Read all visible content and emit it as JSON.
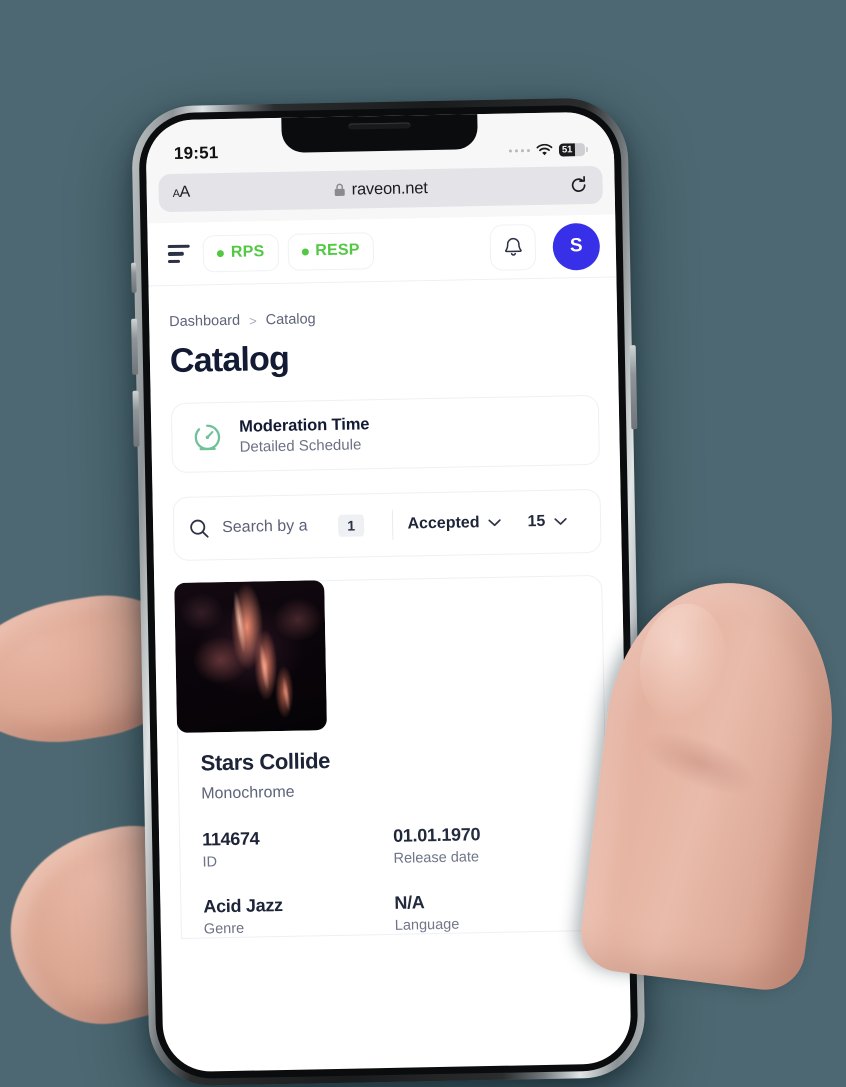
{
  "status_bar": {
    "time": "19:51",
    "battery_level": "51",
    "wifi_icon": "wifi-icon",
    "signal_icon": "signal-dots-icon"
  },
  "browser": {
    "text_size_label": "AA",
    "lock_icon": "lock-icon",
    "url": "raveon.net",
    "reload_icon": "reload-icon"
  },
  "app_header": {
    "menu_icon": "hamburger-menu-icon",
    "chips": [
      {
        "label": "RPS",
        "dot_color": "#52c843"
      },
      {
        "label": "RESP",
        "dot_color": "#52c843"
      }
    ],
    "bell_icon": "bell-icon",
    "avatar_initial": "S",
    "avatar_color": "#3730e8"
  },
  "breadcrumb": {
    "items": [
      "Dashboard",
      "Catalog"
    ],
    "separator": ">"
  },
  "page_title": "Catalog",
  "moderation_card": {
    "icon": "gauge-icon",
    "icon_color": "#6fc19a",
    "title": "Moderation Time",
    "subtitle": "Detailed Schedule"
  },
  "filter_bar": {
    "search_icon": "search-icon",
    "search_placeholder": "Search by a",
    "search_badge": "1",
    "status_select": {
      "value": "Accepted",
      "chevron": "chevron-down-icon"
    },
    "page_size_select": {
      "value": "15",
      "chevron": "chevron-down-icon"
    }
  },
  "item_card": {
    "artwork_alt": "nebula-album-art",
    "title": "Stars Collide",
    "artist": "Monochrome",
    "fields": [
      {
        "value": "114674",
        "label": "ID"
      },
      {
        "value": "01.01.1970",
        "label": "Release date"
      },
      {
        "value": "Acid Jazz",
        "label": "Genre"
      },
      {
        "value": "N/A",
        "label": "Language"
      }
    ]
  }
}
